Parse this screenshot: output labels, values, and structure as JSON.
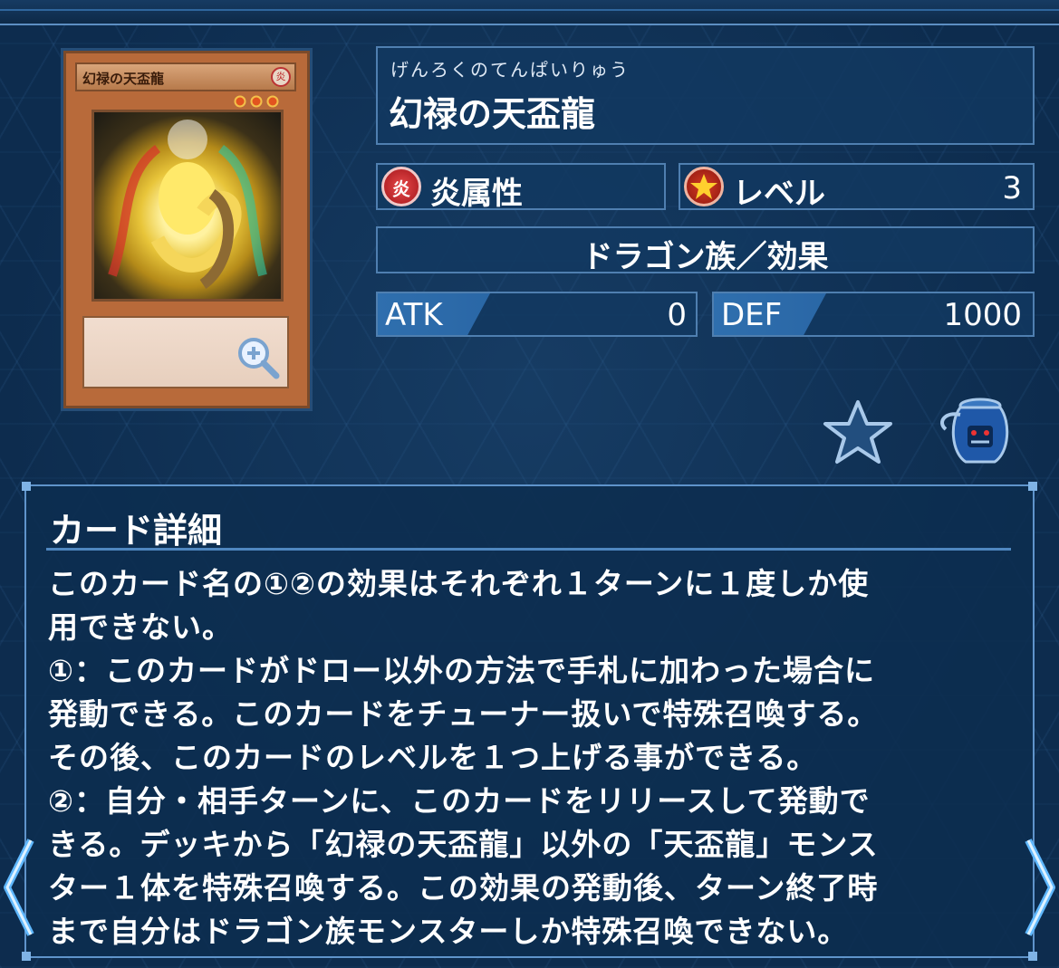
{
  "card": {
    "furigana": "げんろくのてんぱいりゅう",
    "name": "幻禄の天盃龍",
    "attribute_icon_text": "炎",
    "attribute": "炎属性",
    "level_label": "レベル",
    "level": "3",
    "type": "ドラゴン族／効果",
    "atk_label": "ATK",
    "atk": "0",
    "def_label": "DEF",
    "def": "1000",
    "image_name": "幻禄の天盃龍",
    "image_attr": "炎",
    "image_level_stars": 3
  },
  "actions": {
    "favorite_icon": "star-icon",
    "collection_icon": "pot-icon",
    "zoom_icon": "zoom-in-icon"
  },
  "details": {
    "title": "カード詳細",
    "text": "このカード名の①②の効果はそれぞれ１ターンに１度しか使\n用できない。\n①：このカードがドロー以外の方法で手札に加わった場合に\n発動できる。このカードをチューナー扱いで特殊召喚する。\nその後、このカードのレベルを１つ上げる事ができる。\n②：自分・相手ターンに、このカードをリリースして発動で\nきる。デッキから「幻禄の天盃龍」以外の「天盃龍」モンス\nター１体を特殊召喚する。この効果の発動後、ターン終了時\nまで自分はドラゴン族モンスターしか特殊召喚できない。"
  },
  "nav": {
    "prev_icon": "chevron-left-icon",
    "next_icon": "chevron-right-icon"
  },
  "colors": {
    "background": "#0d2c4e",
    "panel": "#123860",
    "accent": "#4f7fb0",
    "fire_red": "#c8262b"
  }
}
